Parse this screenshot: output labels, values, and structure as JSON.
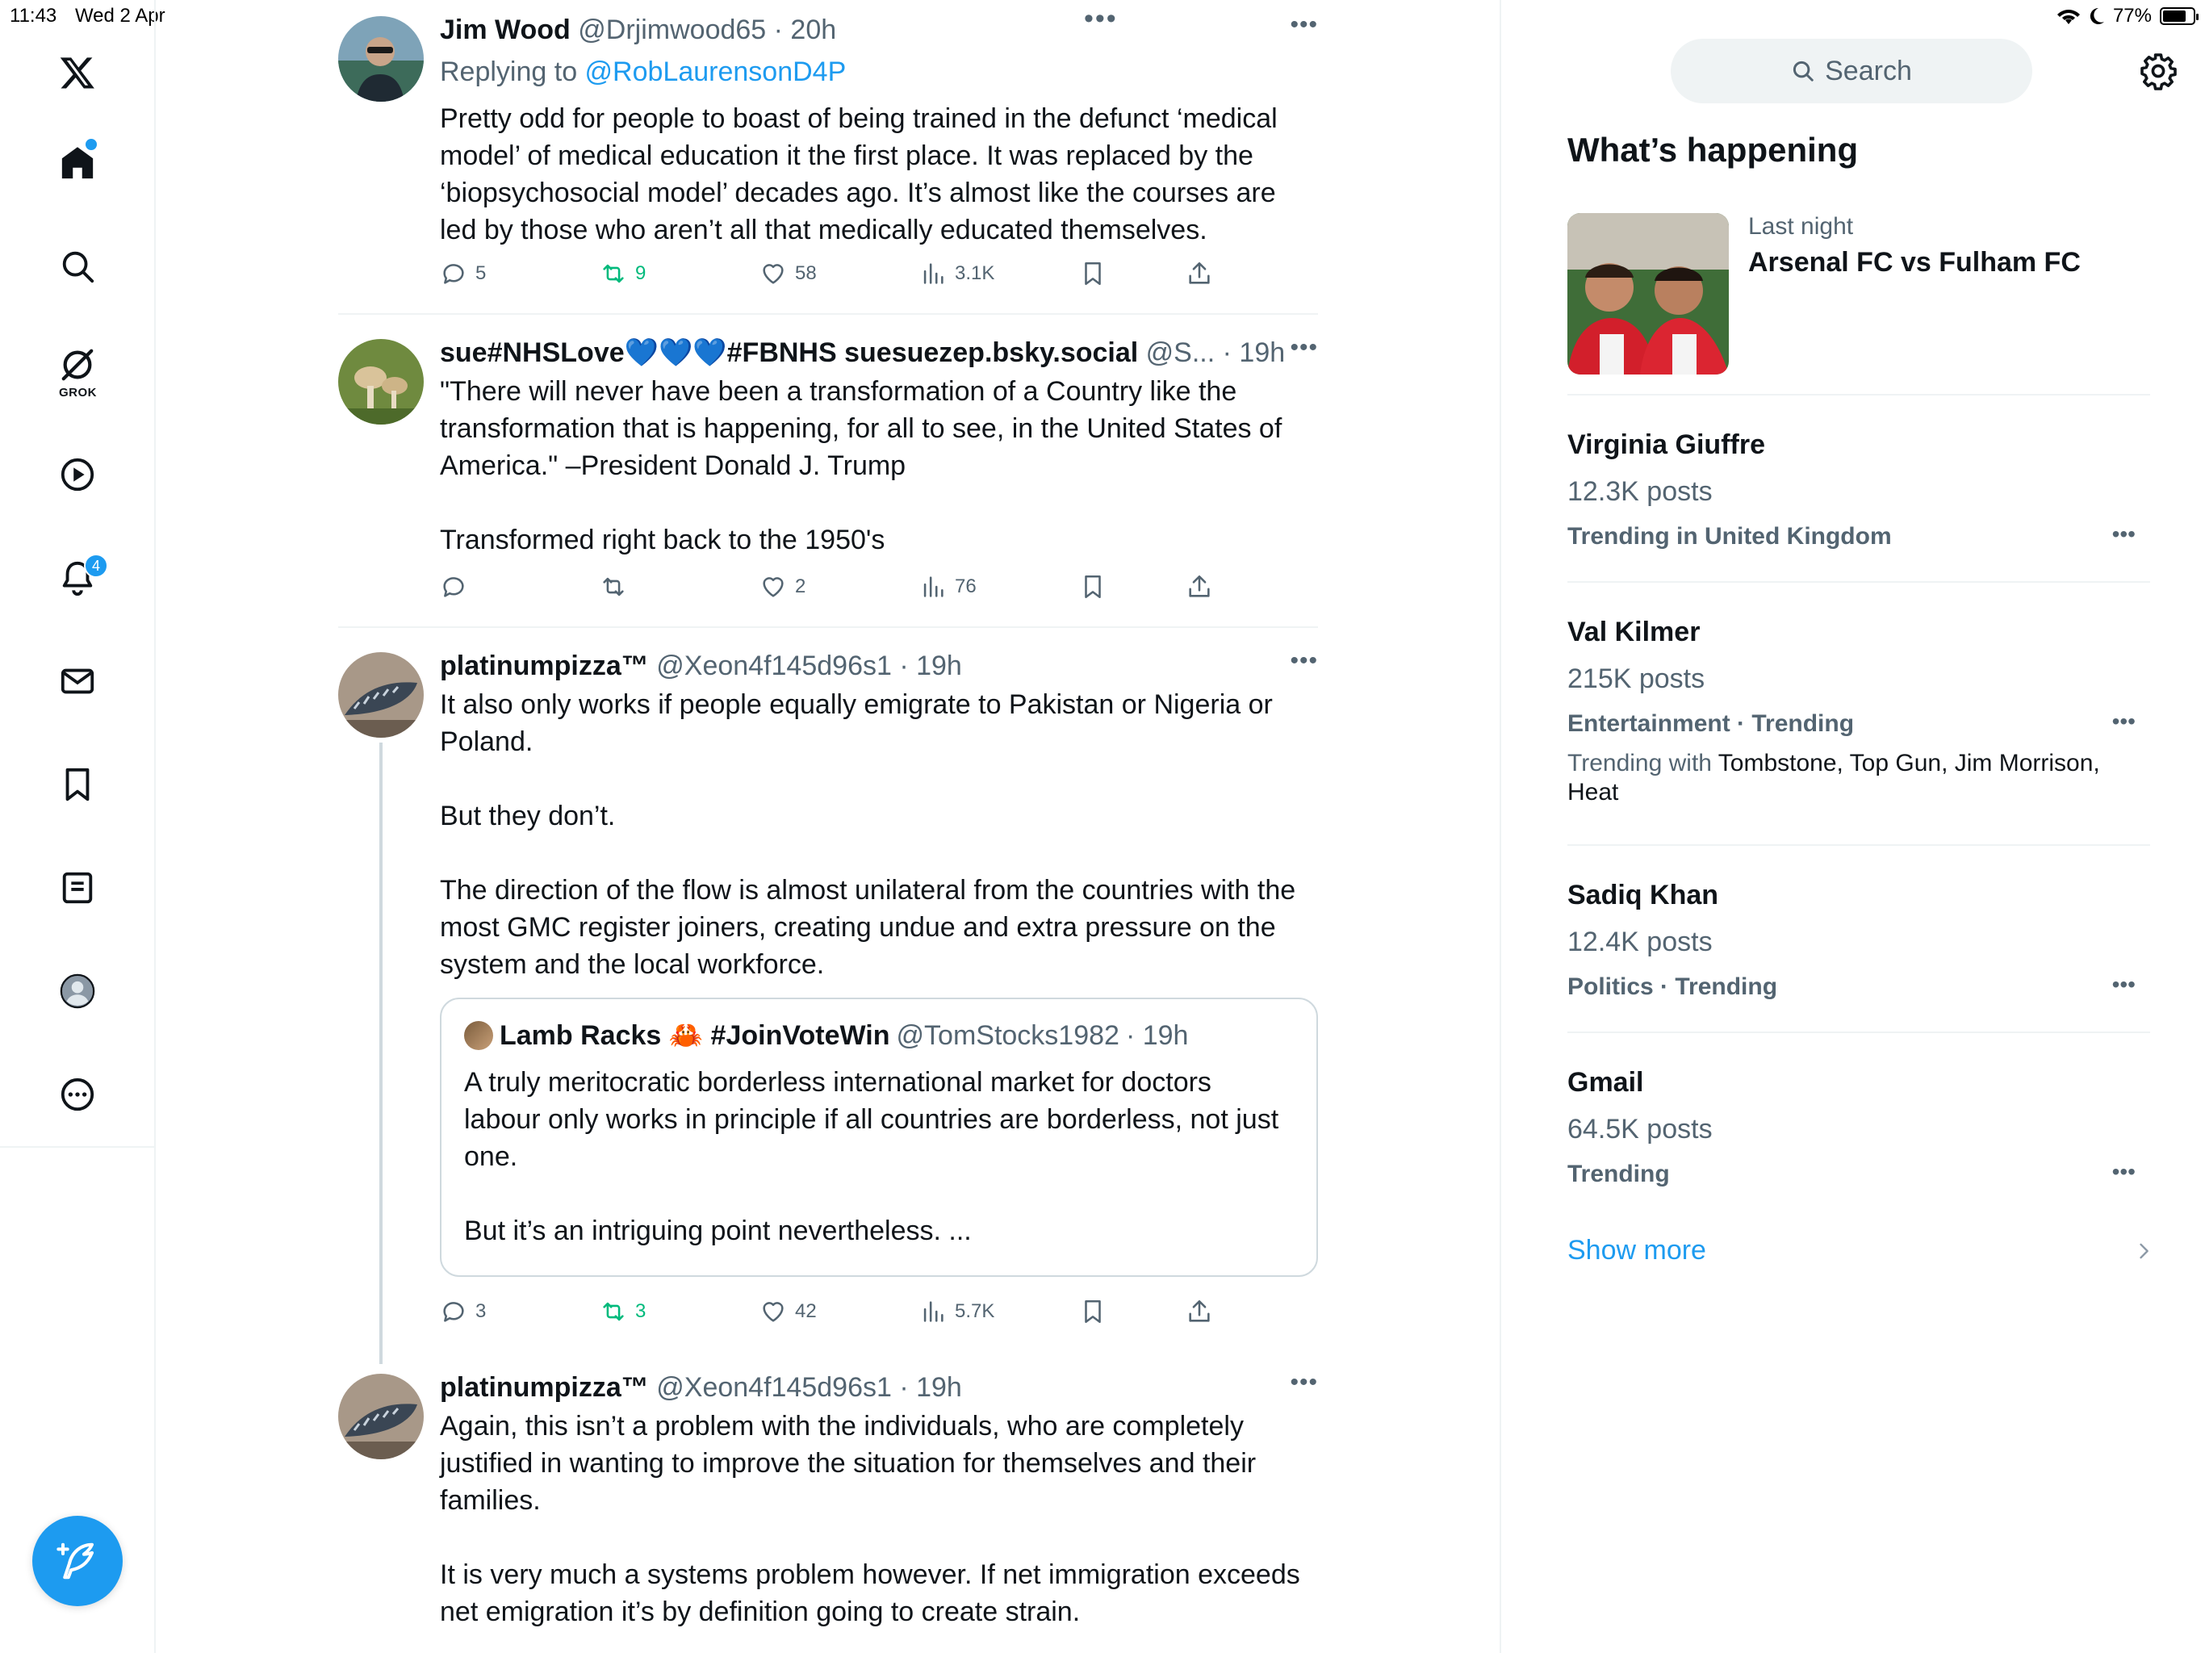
{
  "status_bar": {
    "time": "11:43",
    "date": "Wed 2 Apr",
    "battery": "77%",
    "battery_level": 0.77
  },
  "nav": {
    "grok_label": "GROK",
    "notifications_badge": "4"
  },
  "tweets": [
    {
      "name": "Jim Wood",
      "handle": "@Drjimwood65",
      "time": "· 20h",
      "replying_prefix": "Replying to ",
      "replying_to": "@RobLaurensonD4P",
      "text": "Pretty odd for people to boast of being trained in the defunct ‘medical\nmodel’ of medical education it the first place. It was replaced by the\n‘biopsychosocial model’ decades ago. It’s almost like the courses are\nled by those who aren’t all that medically educated themselves.",
      "replies": "5",
      "reposts": "9",
      "likes": "58",
      "views": "3.1K"
    },
    {
      "name": "sue#NHSLove💙💙💙#FBNHS suesuezep.bsky.social",
      "handle": "@S...",
      "time": "· 19h",
      "text": "\"There will never have been a transformation of a Country like the\ntransformation that is happening, for all to see, in the United States of\nAmerica.\" –President Donald J. Trump\n\nTransformed right back to the 1950's",
      "replies": "",
      "reposts": "",
      "likes": "2",
      "views": "76"
    },
    {
      "name": "platinumpizza™",
      "handle": "@Xeon4f145d96s1",
      "time": "· 19h",
      "text": "It also only works if people equally emigrate to Pakistan or Nigeria or\nPoland.\n\nBut they don’t.\n\nThe direction of the flow is almost unilateral from the countries with the\nmost GMC register joiners, creating undue and extra pressure on the\nsystem and the local workforce.",
      "quote": {
        "name": "Lamb Racks 🦀 #JoinVoteWin",
        "handle": "@TomStocks1982",
        "time": "· 19h",
        "text": "A truly meritocratic borderless international market for doctors\nlabour only works in principle if all countries are borderless, not just\none.\n\nBut it’s an intriguing point nevertheless. ..."
      },
      "replies": "3",
      "reposts": "3",
      "likes": "42",
      "views": "5.7K"
    },
    {
      "name": "platinumpizza™",
      "handle": "@Xeon4f145d96s1",
      "time": "· 19h",
      "text": "Again, this isn’t a problem with the individuals, who are completely\njustified in wanting to improve the situation for themselves and their\nfamilies.\n\nIt is very much a systems problem however. If net immigration exceeds\nnet emigration it’s by definition going to create strain."
    }
  ],
  "sidebar": {
    "search_placeholder": "Search",
    "section_title": "What’s happening",
    "event": {
      "time": "Last night",
      "title": "Arsenal FC vs Fulham FC"
    },
    "trends": [
      {
        "name": "Virginia Giuffre",
        "posts": "12.3K posts",
        "category": "Trending in United Kingdom"
      },
      {
        "name": "Val Kilmer",
        "posts": "215K posts",
        "category": "Entertainment · Trending",
        "with_prefix": "Trending with ",
        "with_topics": "Tombstone, Top Gun, Jim Morrison,\nHeat"
      },
      {
        "name": "Sadiq Khan",
        "posts": "12.4K posts",
        "category": "Politics · Trending"
      },
      {
        "name": "Gmail",
        "posts": "64.5K posts",
        "category": "Trending"
      }
    ],
    "show_more": "Show more"
  },
  "colors": {
    "accent": "#1d9bf0",
    "text_primary": "#0f1419",
    "text_secondary": "#536471",
    "repost_green": "#00ba7c",
    "border": "#eff3f4"
  }
}
